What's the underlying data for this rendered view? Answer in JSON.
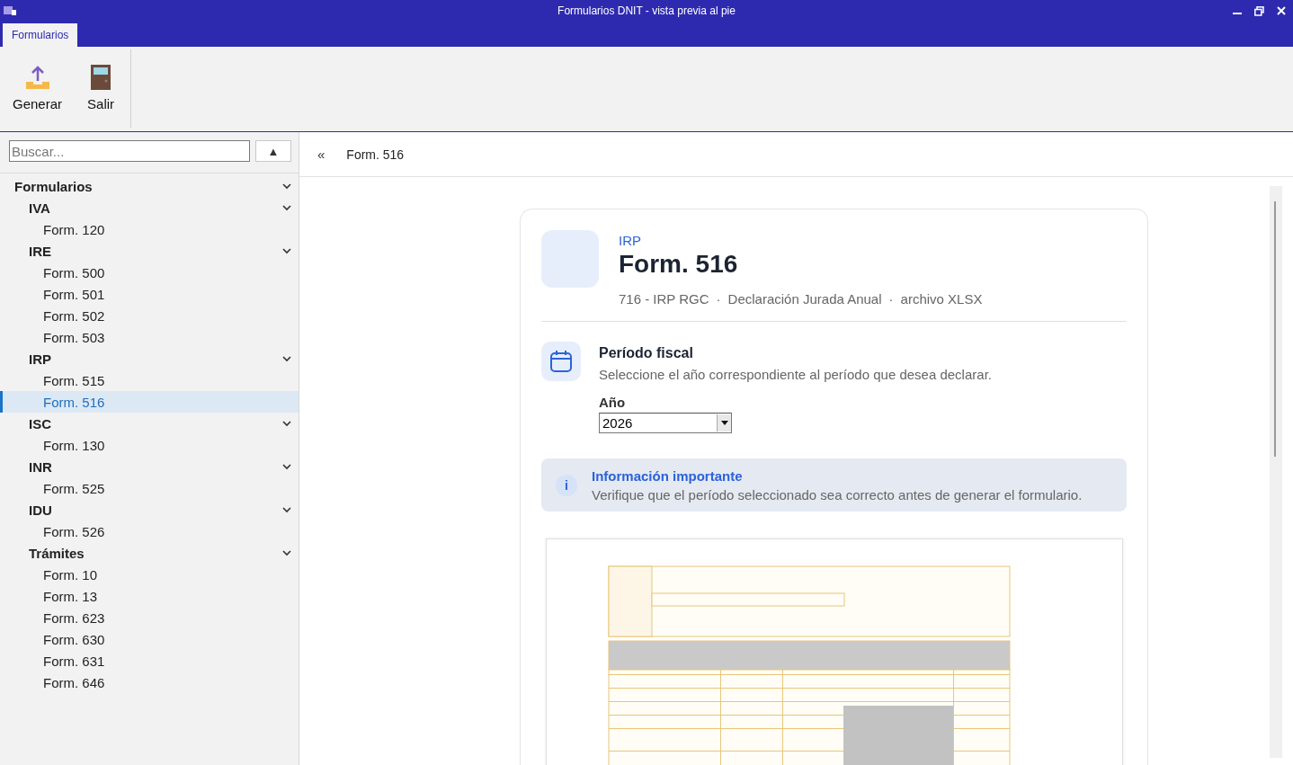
{
  "window": {
    "title": "Formularios DNIT - vista previa al pie"
  },
  "ribbon_tabs": [
    {
      "label": "Formularios",
      "selected": true
    }
  ],
  "toolbar": [
    {
      "kind": "upload",
      "label": "Generar"
    },
    {
      "kind": "door",
      "label": "Salir"
    }
  ],
  "search": {
    "placeholder": "Buscar...",
    "button": "▲"
  },
  "tree": [
    {
      "label": "Formularios",
      "expanded": true,
      "children": [
        {
          "label": "IVA",
          "expanded": true,
          "children": [
            {
              "label": "Form. 120",
              "selected": false
            }
          ]
        },
        {
          "label": "IRE",
          "expanded": true,
          "children": [
            {
              "label": "Form. 500",
              "selected": false
            },
            {
              "label": "Form. 501",
              "selected": false
            },
            {
              "label": "Form. 502",
              "selected": false
            },
            {
              "label": "Form. 503",
              "selected": false
            }
          ]
        },
        {
          "label": "IRP",
          "expanded": true,
          "children": [
            {
              "label": "Form. 515",
              "selected": false
            },
            {
              "label": "Form. 516",
              "selected": true
            }
          ]
        },
        {
          "label": "ISC",
          "expanded": true,
          "children": [
            {
              "label": "Form. 130",
              "selected": false
            }
          ]
        },
        {
          "label": "INR",
          "expanded": true,
          "children": [
            {
              "label": "Form. 525",
              "selected": false
            }
          ]
        },
        {
          "label": "IDU",
          "expanded": true,
          "children": [
            {
              "label": "Form. 526",
              "selected": false
            }
          ]
        },
        {
          "label": "Trámites",
          "expanded": true,
          "children": [
            {
              "label": "Form. 10",
              "selected": false
            },
            {
              "label": "Form. 13",
              "selected": false
            },
            {
              "label": "Form. 623",
              "selected": false
            },
            {
              "label": "Form. 630",
              "selected": false
            },
            {
              "label": "Form. 631",
              "selected": false
            },
            {
              "label": "Form. 646",
              "selected": false
            }
          ]
        }
      ]
    }
  ],
  "breadcrumb": {
    "toggle": "«",
    "current": "Form. 516"
  },
  "card": {
    "category": "IRP",
    "title": "Form. 516",
    "meta": [
      "716 - IRP RGC",
      "Declaración Jurada Anual",
      "archivo XLSX"
    ],
    "separator": "·",
    "period": {
      "title": "Período fiscal",
      "description": "Seleccione el año correspondiente al período que desea declarar.",
      "year_label": "Año",
      "year": "2026"
    },
    "info": {
      "icon": "i",
      "title": "Información importante",
      "text": "Verifique que el período seleccionado sea correcto antes de generar el formulario."
    },
    "preview": {
      "kind": "picture"
    }
  }
}
